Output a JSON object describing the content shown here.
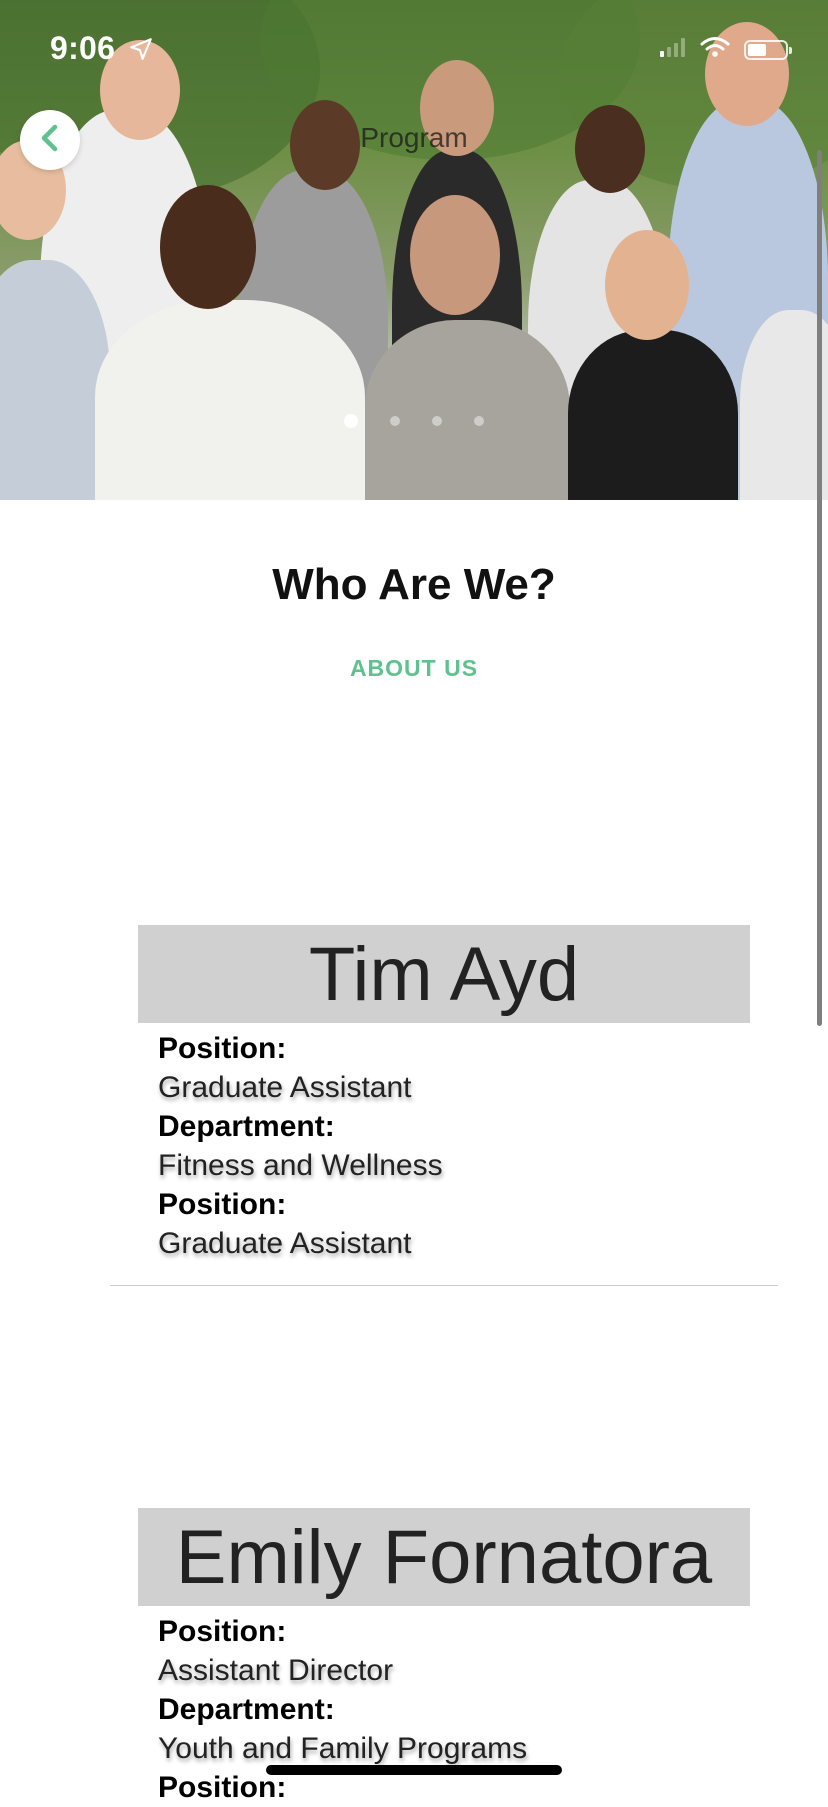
{
  "status_bar": {
    "time": "9:06"
  },
  "nav": {
    "title": "Program"
  },
  "hero": {
    "page_count": 4,
    "active_page": 1
  },
  "intro": {
    "heading": "Who Are We?",
    "label": "ABOUT US",
    "label_color": "#5fc18e"
  },
  "staff": [
    {
      "name": "Tim Ayd",
      "fields": [
        {
          "label": "Position:",
          "value": "Graduate Assistant"
        },
        {
          "label": "Department:",
          "value": "Fitness and Wellness"
        },
        {
          "label": "Position:",
          "value": "Graduate Assistant"
        }
      ]
    },
    {
      "name": "Emily Fornatora",
      "fields": [
        {
          "label": "Position:",
          "value": "Assistant Director"
        },
        {
          "label": "Department:",
          "value": "Youth and Family Programs"
        },
        {
          "label": "Position:",
          "value": ""
        }
      ]
    }
  ],
  "icons": {
    "back": "chevron-left-icon",
    "location": "location-arrow-icon",
    "signal": "cellular-signal-icon",
    "wifi": "wifi-icon",
    "battery": "battery-icon"
  }
}
